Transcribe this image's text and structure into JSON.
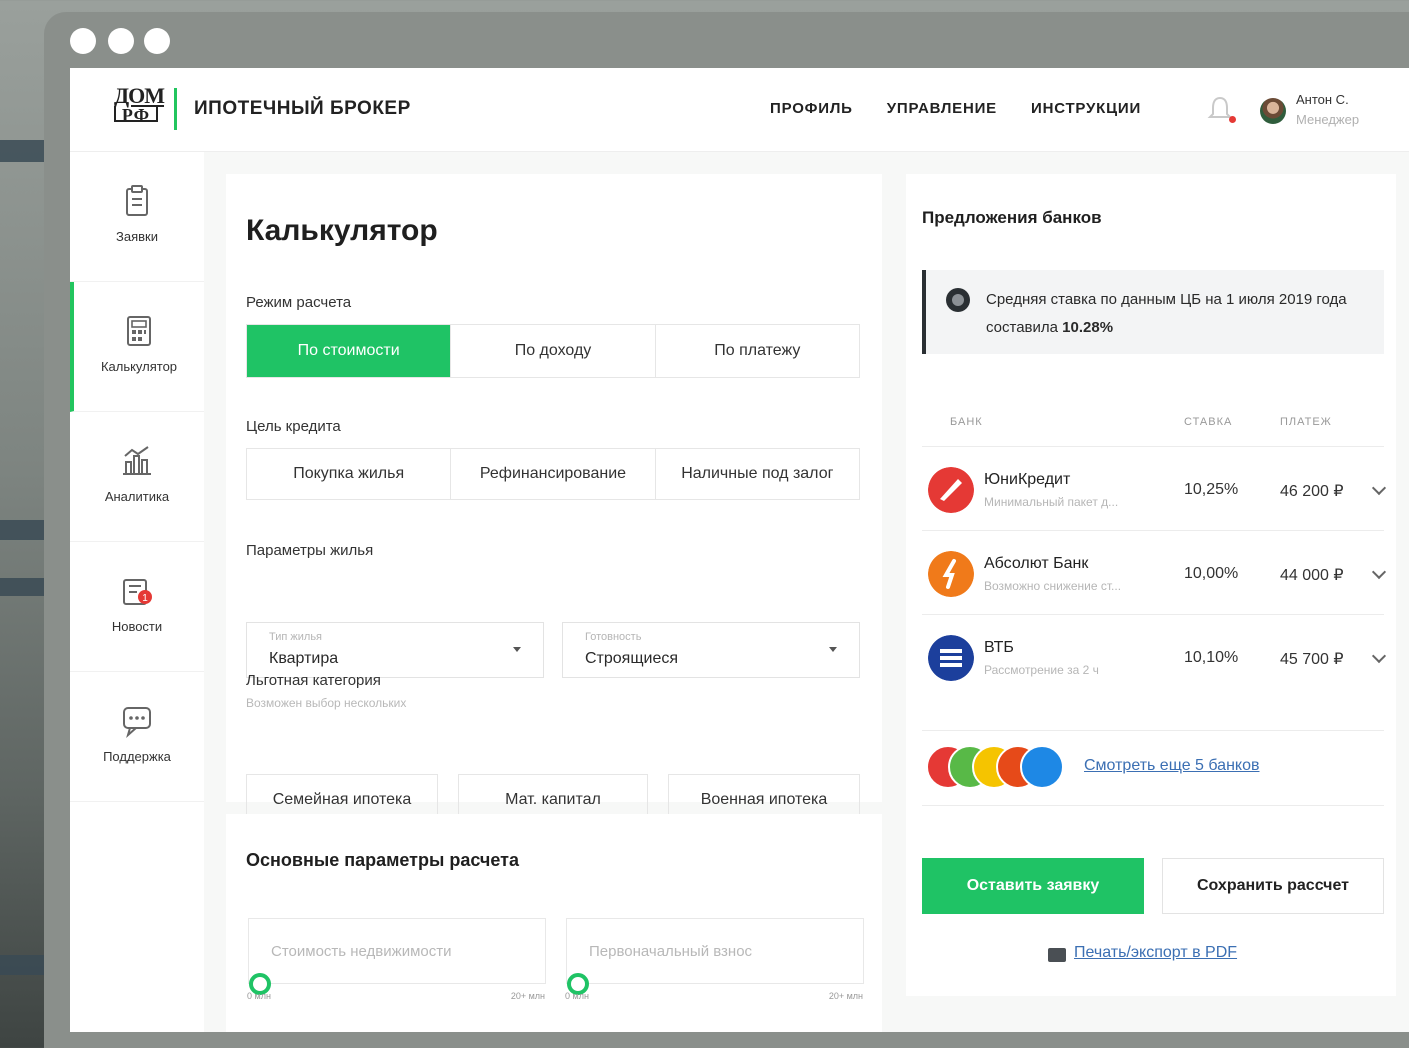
{
  "header": {
    "brand": "ИПОТЕЧНЫЙ БРОКЕР",
    "logo_top": "ДОМ",
    "logo_bottom": "РФ",
    "nav": [
      "ПРОФИЛЬ",
      "УПРАВЛЕНИЕ",
      "ИНСТРУКЦИИ"
    ],
    "user": {
      "name": "Антон С.",
      "role": "Менеджер"
    }
  },
  "sidebar": {
    "items": [
      {
        "label": "Заявки",
        "icon": "clipboard-icon"
      },
      {
        "label": "Калькулятор",
        "icon": "calculator-icon",
        "active": true
      },
      {
        "label": "Аналитика",
        "icon": "chart-icon"
      },
      {
        "label": "Новости",
        "icon": "news-icon",
        "badge": "1"
      },
      {
        "label": "Поддержка",
        "icon": "chat-icon"
      }
    ]
  },
  "calculator": {
    "title": "Калькулятор",
    "mode_label": "Режим расчета",
    "modes": [
      "По стоимости",
      "По доходу",
      "По платежу"
    ],
    "goal_label": "Цель кредита",
    "goals": [
      "Покупка жилья",
      "Рефинансирование",
      "Наличные под залог"
    ],
    "housing_label": "Параметры жилья",
    "housing_type": {
      "caption": "Тип жилья",
      "value": "Квартира"
    },
    "readiness": {
      "caption": "Готовность",
      "value": "Строящиеся"
    },
    "benefit_label": "Льготная категория",
    "benefit_hint": "Возможен выбор нескольких",
    "benefits": [
      "Семейная ипотека",
      "Мат. капитал",
      "Военная ипотека"
    ]
  },
  "params": {
    "title": "Основные параметры расчета",
    "property_cost": {
      "placeholder": "Стоимость недвижимости",
      "min": "0 млн",
      "max": "20+ млн"
    },
    "down_payment": {
      "placeholder": "Первоначальный взнос",
      "min": "0 млн",
      "max": "20+ млн"
    }
  },
  "offers": {
    "title": "Предложения банков",
    "notice": "Средняя ставка по данным ЦБ на 1 июля 2019 года составила ",
    "notice_rate": "10.28%",
    "columns": {
      "bank": "БАНК",
      "rate": "СТАВКА",
      "payment": "ПЛАТЕЖ"
    },
    "banks": [
      {
        "name": "ЮниКредит",
        "desc": "Минимальный пакет д...",
        "rate": "10,25%",
        "payment": "46 200 ₽",
        "color": "#e53935"
      },
      {
        "name": "Абсолют Банк",
        "desc": "Возможно снижение ст...",
        "rate": "10,00%",
        "payment": "44 000 ₽",
        "color": "#f07a1a"
      },
      {
        "name": "ВТБ",
        "desc": "Рассмотрение за 2 ч",
        "rate": "10,10%",
        "payment": "45 700 ₽",
        "color": "#1c3f9c"
      }
    ],
    "more_link": "Смотреть еще 5 банков",
    "more_logos": [
      "#e53935",
      "#58b947",
      "#f5c400",
      "#e64a19",
      "#1e88e5"
    ],
    "submit": "Оставить заявку",
    "save": "Сохранить рассчет",
    "print": "Печать/экспорт в PDF"
  }
}
